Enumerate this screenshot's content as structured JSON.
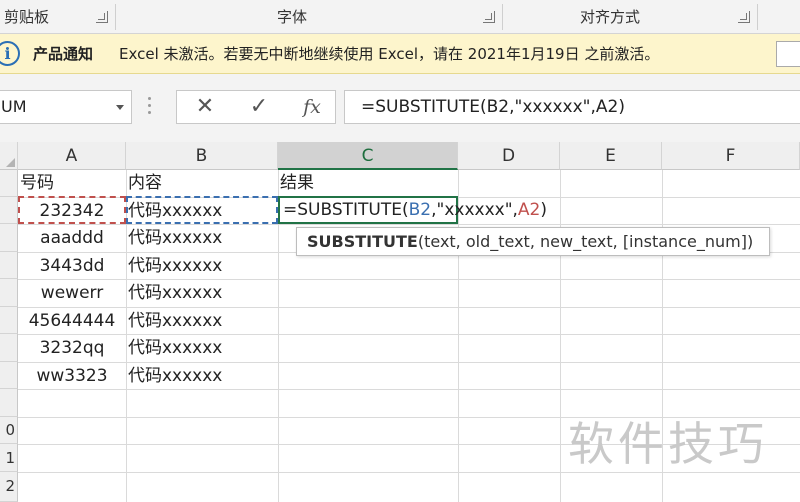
{
  "ribbon": {
    "groups": [
      {
        "label": "剪贴板"
      },
      {
        "label": "字体"
      },
      {
        "label": "对齐方式"
      }
    ]
  },
  "notification": {
    "icon": "info-icon",
    "title": "产品通知",
    "message": "Excel 未激活。若要无中断地继续使用 Excel，请在 2021年1月19日 之前激活。"
  },
  "formula_bar": {
    "name_box": "UM",
    "cancel_symbol": "✕",
    "enter_symbol": "✓",
    "fx_label": "fx",
    "formula": "=SUBSTITUTE(B2,\"xxxxxx\",A2)"
  },
  "sheet": {
    "columns": [
      "A",
      "B",
      "C",
      "D",
      "E",
      "F"
    ],
    "selected_column": "C",
    "headers": {
      "A": "号码",
      "B": "内容",
      "C": "结果"
    },
    "rows": [
      {
        "a": "232342",
        "b": "代码xxxxxx"
      },
      {
        "a": "aaaddd",
        "b": "代码xxxxxx"
      },
      {
        "a": "3443dd",
        "b": "代码xxxxxx"
      },
      {
        "a": "wewerr",
        "b": "代码xxxxxx"
      },
      {
        "a": "45644444",
        "b": "代码xxxxxx"
      },
      {
        "a": "3232qq",
        "b": "代码xxxxxx"
      },
      {
        "a": "ww3323",
        "b": "代码xxxxxx"
      }
    ],
    "row_numbers_visible": [
      "0",
      "1",
      "2"
    ],
    "editing": {
      "prefix": "=SUBSTITUTE(",
      "ref1": "B2",
      "middle": ",\"xxxxxx\",",
      "ref2": "A2",
      "suffix": ")"
    },
    "tooltip": {
      "func": "SUBSTITUTE",
      "args": "(text, old_text, new_text, [instance_num])"
    }
  },
  "watermark": "软件技巧",
  "colors": {
    "selection_green": "#217346",
    "ref_blue": "#3a6fb0",
    "ref_red": "#c0504d",
    "notify_bg": "#fdf5cc"
  }
}
